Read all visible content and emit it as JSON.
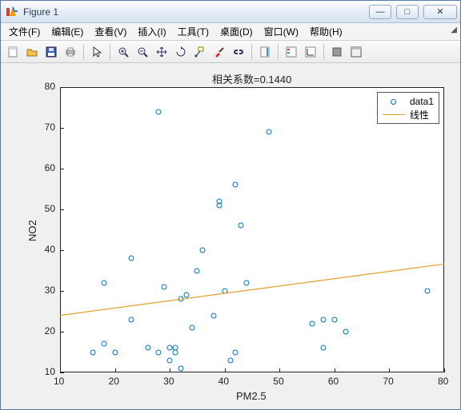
{
  "window": {
    "title": "Figure 1",
    "buttons": {
      "min": "—",
      "max": "□",
      "close": "✕"
    }
  },
  "menu": {
    "file": "文件(F)",
    "edit": "编辑(E)",
    "view": "查看(V)",
    "insert": "插入(I)",
    "tools": "工具(T)",
    "desktop": "桌面(D)",
    "window": "窗口(W)",
    "help": "帮助(H)"
  },
  "toolbar_icons": [
    "new-figure-icon",
    "open-icon",
    "save-icon",
    "print-icon",
    "sep",
    "pointer-icon",
    "sep",
    "zoom-in-icon",
    "zoom-out-icon",
    "pan-icon",
    "rotate-icon",
    "data-cursor-icon",
    "brush-icon",
    "link-icon",
    "sep",
    "colorbar-icon",
    "sep",
    "insert-legend-icon",
    "insert-axes-icon",
    "sep",
    "hide-tools-icon",
    "dock-icon"
  ],
  "chart_data": {
    "type": "scatter",
    "title": "相关系数=0.1440",
    "xlabel": "PM2.5",
    "ylabel": "NO2",
    "xlim": [
      10,
      80
    ],
    "ylim": [
      10,
      80
    ],
    "xticks": [
      10,
      20,
      30,
      40,
      50,
      60,
      70,
      80
    ],
    "yticks": [
      10,
      20,
      30,
      40,
      50,
      60,
      70,
      80
    ],
    "series": [
      {
        "name": "data1",
        "type": "scatter",
        "color": "#0072bd",
        "points": [
          [
            16,
            15
          ],
          [
            18,
            32
          ],
          [
            18,
            17
          ],
          [
            20,
            15
          ],
          [
            23,
            38
          ],
          [
            23,
            23
          ],
          [
            26,
            16
          ],
          [
            28,
            15
          ],
          [
            28,
            74
          ],
          [
            29,
            31
          ],
          [
            30,
            13
          ],
          [
            30,
            16
          ],
          [
            31,
            16
          ],
          [
            31,
            15
          ],
          [
            32,
            11
          ],
          [
            32,
            28
          ],
          [
            33,
            29
          ],
          [
            34,
            21
          ],
          [
            35,
            35
          ],
          [
            36,
            40
          ],
          [
            38,
            24
          ],
          [
            39,
            52
          ],
          [
            39,
            51
          ],
          [
            40,
            30
          ],
          [
            41,
            13
          ],
          [
            42,
            15
          ],
          [
            42,
            56
          ],
          [
            43,
            46
          ],
          [
            44,
            32
          ],
          [
            48,
            69
          ],
          [
            56,
            22
          ],
          [
            58,
            23
          ],
          [
            58,
            16
          ],
          [
            60,
            23
          ],
          [
            62,
            20
          ],
          [
            77,
            30
          ]
        ]
      },
      {
        "name": "线性",
        "type": "line",
        "color": "#e0a030",
        "fit": {
          "slope": 0.18,
          "intercept": 22.2
        }
      }
    ],
    "legend": {
      "position": "northeast",
      "entries": [
        "data1",
        "线性"
      ]
    }
  }
}
